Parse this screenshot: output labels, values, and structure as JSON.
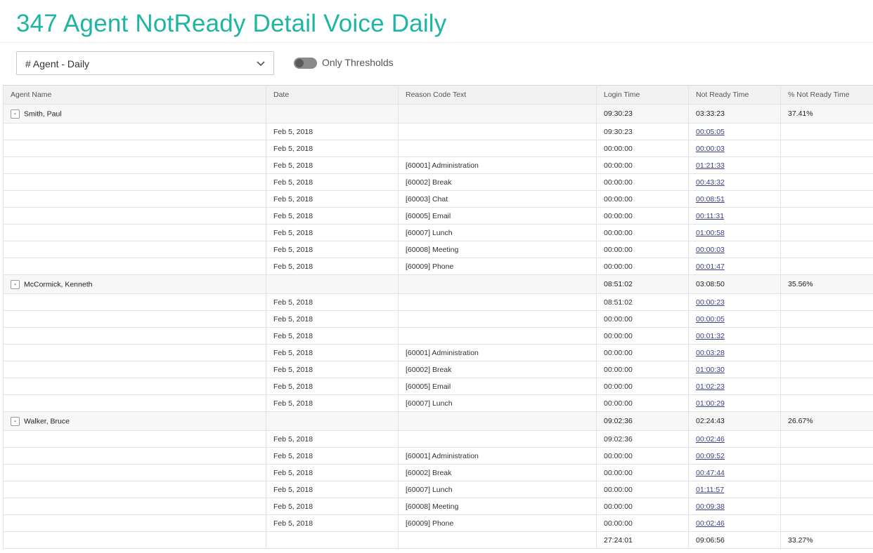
{
  "header": {
    "title": "347 Agent NotReady Detail Voice Daily"
  },
  "controls": {
    "grouping_select": {
      "value": "# Agent - Daily"
    },
    "thresholds_toggle": {
      "label": "Only Thresholds",
      "on": false
    }
  },
  "table": {
    "columns": [
      "Agent Name",
      "Date",
      "Reason Code Text",
      "Login Time",
      "Not Ready Time",
      "% Not Ready Time"
    ],
    "groups": [
      {
        "agent": "Smith, Paul",
        "collapse_symbol": "-",
        "summary": {
          "login": "09:30:23",
          "not_ready": "03:33:23",
          "pct": "37.41%"
        },
        "rows": [
          {
            "date": "Feb 5, 2018",
            "reason": "",
            "login": "09:30:23",
            "not_ready": "00:05:05"
          },
          {
            "date": "Feb 5, 2018",
            "reason": "",
            "login": "00:00:00",
            "not_ready": "00:00:03"
          },
          {
            "date": "Feb 5, 2018",
            "reason": "[60001] Administration",
            "login": "00:00:00",
            "not_ready": "01:21:33"
          },
          {
            "date": "Feb 5, 2018",
            "reason": "[60002] Break",
            "login": "00:00:00",
            "not_ready": "00:43:32"
          },
          {
            "date": "Feb 5, 2018",
            "reason": "[60003] Chat",
            "login": "00:00:00",
            "not_ready": "00:08:51"
          },
          {
            "date": "Feb 5, 2018",
            "reason": "[60005] Email",
            "login": "00:00:00",
            "not_ready": "00:11:31"
          },
          {
            "date": "Feb 5, 2018",
            "reason": "[60007] Lunch",
            "login": "00:00:00",
            "not_ready": "01:00:58"
          },
          {
            "date": "Feb 5, 2018",
            "reason": "[60008] Meeting",
            "login": "00:00:00",
            "not_ready": "00:00:03"
          },
          {
            "date": "Feb 5, 2018",
            "reason": "[60009] Phone",
            "login": "00:00:00",
            "not_ready": "00:01:47"
          }
        ]
      },
      {
        "agent": "McCormick, Kenneth",
        "collapse_symbol": "-",
        "summary": {
          "login": "08:51:02",
          "not_ready": "03:08:50",
          "pct": "35.56%"
        },
        "rows": [
          {
            "date": "Feb 5, 2018",
            "reason": "",
            "login": "08:51:02",
            "not_ready": "00:00:23"
          },
          {
            "date": "Feb 5, 2018",
            "reason": "",
            "login": "00:00:00",
            "not_ready": "00:00:05"
          },
          {
            "date": "Feb 5, 2018",
            "reason": "",
            "login": "00:00:00",
            "not_ready": "00:01:32"
          },
          {
            "date": "Feb 5, 2018",
            "reason": "[60001] Administration",
            "login": "00:00:00",
            "not_ready": "00:03:28"
          },
          {
            "date": "Feb 5, 2018",
            "reason": "[60002] Break",
            "login": "00:00:00",
            "not_ready": "01:00:30"
          },
          {
            "date": "Feb 5, 2018",
            "reason": "[60005] Email",
            "login": "00:00:00",
            "not_ready": "01:02:23"
          },
          {
            "date": "Feb 5, 2018",
            "reason": "[60007] Lunch",
            "login": "00:00:00",
            "not_ready": "01:00:29"
          }
        ]
      },
      {
        "agent": "Walker, Bruce",
        "collapse_symbol": "-",
        "summary": {
          "login": "09:02:36",
          "not_ready": "02:24:43",
          "pct": "26.67%"
        },
        "rows": [
          {
            "date": "Feb 5, 2018",
            "reason": "",
            "login": "09:02:36",
            "not_ready": "00:02:46"
          },
          {
            "date": "Feb 5, 2018",
            "reason": "[60001] Administration",
            "login": "00:00:00",
            "not_ready": "00:09:52"
          },
          {
            "date": "Feb 5, 2018",
            "reason": "[60002] Break",
            "login": "00:00:00",
            "not_ready": "00:47:44"
          },
          {
            "date": "Feb 5, 2018",
            "reason": "[60007] Lunch",
            "login": "00:00:00",
            "not_ready": "01:11:57"
          },
          {
            "date": "Feb 5, 2018",
            "reason": "[60008] Meeting",
            "login": "00:00:00",
            "not_ready": "00:09:38"
          },
          {
            "date": "Feb 5, 2018",
            "reason": "[60009] Phone",
            "login": "00:00:00",
            "not_ready": "00:02:46"
          }
        ]
      }
    ],
    "total": {
      "login": "27:24:01",
      "not_ready": "09:06:56",
      "pct": "33.27%"
    }
  },
  "colors": {
    "title": "#1fb5a3",
    "link": "#3a3f8e",
    "header_bg": "#f2f2f2"
  }
}
